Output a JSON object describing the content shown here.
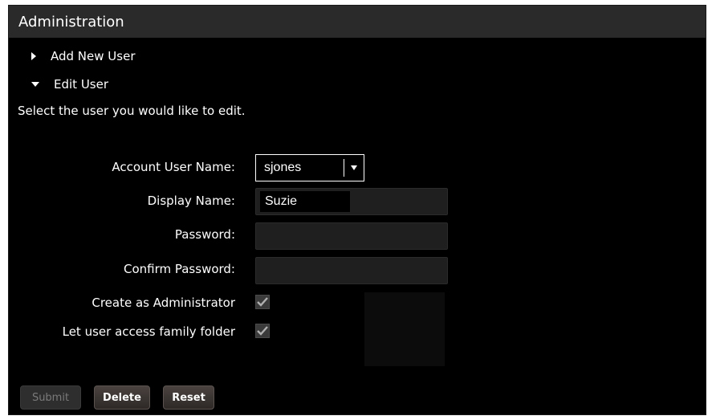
{
  "header": {
    "title": "Administration"
  },
  "sections": {
    "add_new_user": "Add New User",
    "edit_user": "Edit User"
  },
  "instruction": "Select the user you would like to edit.",
  "form": {
    "account_user_name": {
      "label": "Account User Name:",
      "value": "sjones"
    },
    "display_name": {
      "label": "Display Name:",
      "value": "Suzie"
    },
    "password": {
      "label": "Password:",
      "value": ""
    },
    "confirm_password": {
      "label": "Confirm Password:",
      "value": ""
    },
    "create_admin": {
      "label": "Create as Administrator",
      "checked": true
    },
    "family_folder": {
      "label": "Let user access family folder",
      "checked": true
    }
  },
  "buttons": {
    "submit": "Submit",
    "delete": "Delete",
    "reset": "Reset"
  },
  "colors": {
    "panel_bg": "#000000",
    "header_bg": "#2a2a2a",
    "input_bg": "#1f1f1f",
    "button_bg": "#3c3532",
    "disabled_text": "#7a7a7a",
    "check_mark": "#b0b0b0"
  },
  "icons": {
    "collapsed": "triangle-right-icon",
    "expanded": "triangle-down-icon",
    "dropdown": "chevron-down-icon",
    "check": "checkmark-icon"
  }
}
